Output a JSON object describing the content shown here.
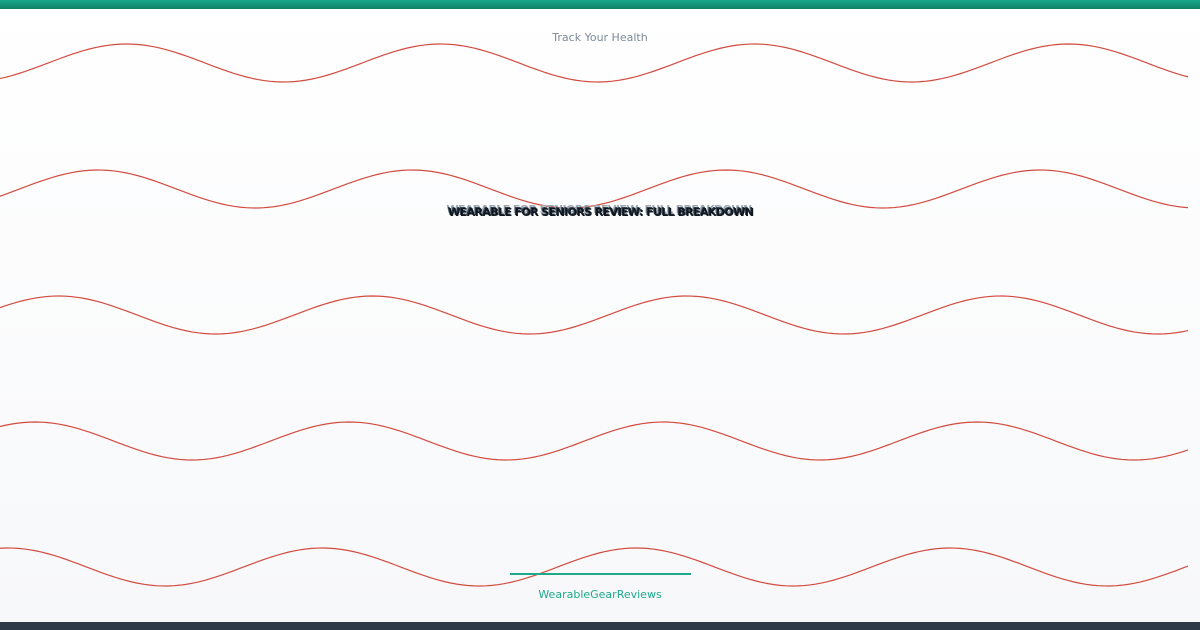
{
  "header": {
    "tagline": "Track Your Health"
  },
  "hero": {
    "headline": "WEARABLE FOR SENIORS REVIEW: FULL BREAKDOWN"
  },
  "footer": {
    "brand": "WearableGearReviews"
  },
  "theme": {
    "accent": "#1ea98b",
    "top_bar": "#18a989",
    "bottom_bar": "#2e3a47",
    "wave": "#d24b3f",
    "text_muted": "#7f8a96",
    "text_dark": "#0f1720"
  }
}
